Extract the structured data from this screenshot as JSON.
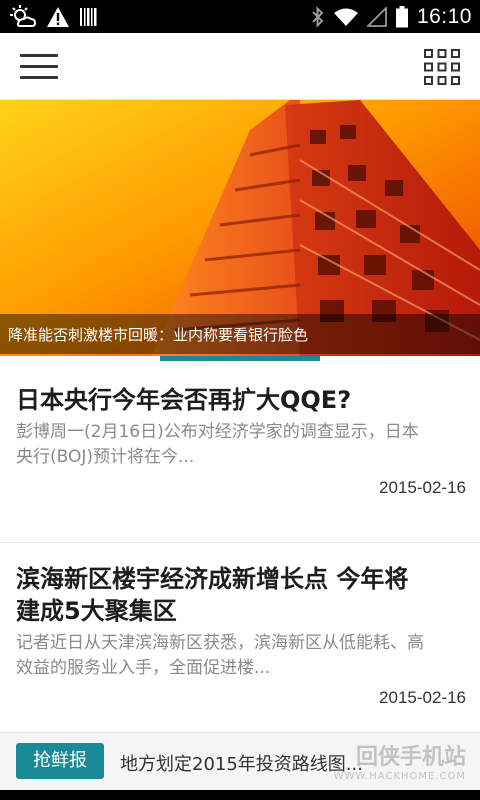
{
  "status_bar": {
    "time": "16:10",
    "icons": [
      "weather-icon",
      "alert-icon",
      "barcode-icon",
      "bluetooth-icon",
      "wifi-icon",
      "signal-icon",
      "battery-icon"
    ]
  },
  "app_bar": {
    "menu_icon": "hamburger-menu-icon",
    "apps_icon": "grid-apps-icon"
  },
  "banner": {
    "caption": "降准能否刺激楼市回暖：业内称要看银行脸色",
    "slide_count": 3,
    "active_slide": 2
  },
  "news": [
    {
      "title": "日本央行今年会否再扩大QQE?",
      "summary_line1": "彭博周一(2月16日)公布对经济学家的调查显示，日本",
      "summary_line2": "央行(BOJ)预计将在今...",
      "date": "2015-02-16"
    },
    {
      "title_line1": "滨海新区楼宇经济成新增长点 今年将",
      "title_line2": "建成5大聚集区",
      "summary_line1": "记者近日从天津滨海新区获悉，滨海新区从低能耗、高",
      "summary_line2": "效益的服务业入手，全面促进楼...",
      "date": "2015-02-16"
    }
  ],
  "ticker": {
    "badge": "抢鲜报",
    "text": "地方划定2015年投资路线图...",
    "watermark_brand": "回侠手机站",
    "watermark_url": "WWW.HACKHOME.COM"
  },
  "colors": {
    "accent": "#1a8a96",
    "status_bar_bg": "#000000"
  }
}
